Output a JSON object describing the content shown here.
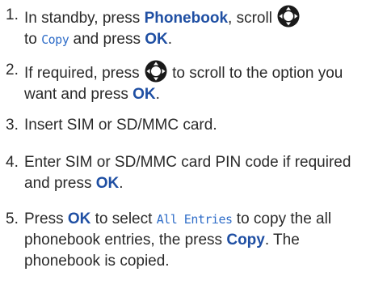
{
  "steps": [
    {
      "number": "1.",
      "a": "In standby, press ",
      "phonebook_key": "Phonebook",
      "b": ", scroll ",
      "icon": "navigation-key-icon",
      "c": "to ",
      "copy_display": "Copy",
      "d": " and press ",
      "ok_key": "OK",
      "e": "."
    },
    {
      "number": "2.",
      "a": "If required, press ",
      "icon": "navigation-key-icon",
      "b": " to scroll to the option you want and press ",
      "ok_key": "OK",
      "c": "."
    },
    {
      "number": "3.",
      "text": "Insert SIM or SD/MMC card."
    },
    {
      "number": "4.",
      "a": "Enter SIM or SD/MMC card PIN code if required and press ",
      "ok_key": "OK",
      "b": "."
    },
    {
      "number": "5.",
      "a": "Press ",
      "ok_key": "OK",
      "b": " to select ",
      "all_entries_display": "All Entries",
      "c": " to copy the all phonebook entries, the press ",
      "copy_key": "Copy",
      "d": ". The phonebook is copied."
    }
  ],
  "colors": {
    "text": "#2a2a2a",
    "key_blue": "#1f4fa3",
    "display_blue": "#2f6dc8"
  }
}
